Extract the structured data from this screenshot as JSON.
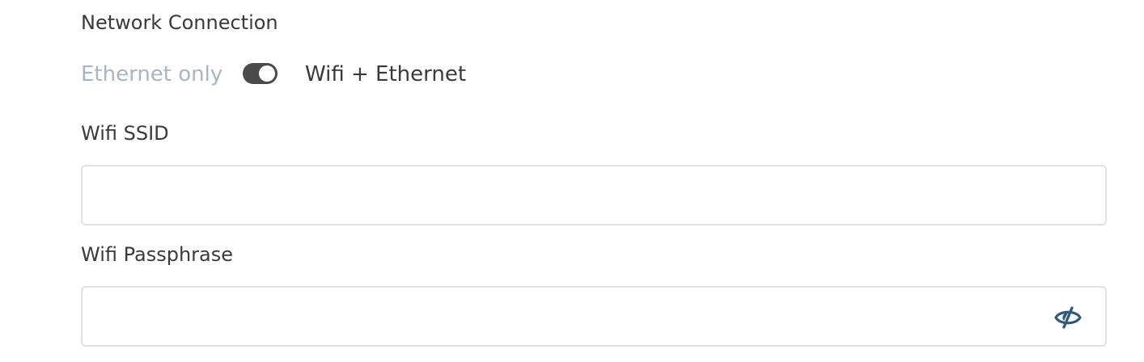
{
  "network": {
    "label": "Network Connection",
    "option_left": "Ethernet only",
    "option_right": "Wifi + Ethernet",
    "toggle_on": true
  },
  "ssid": {
    "label": "Wifi SSID",
    "value": "",
    "placeholder": ""
  },
  "passphrase": {
    "label": "Wifi Passphrase",
    "value": "",
    "placeholder": "",
    "toggle_icon": "eye-slash-icon"
  },
  "colors": {
    "text": "#3a3a3a",
    "muted": "#a7b6c2",
    "toggle": "#4a4a4a",
    "border": "#dde2e7",
    "icon": "#2f5a7a"
  }
}
